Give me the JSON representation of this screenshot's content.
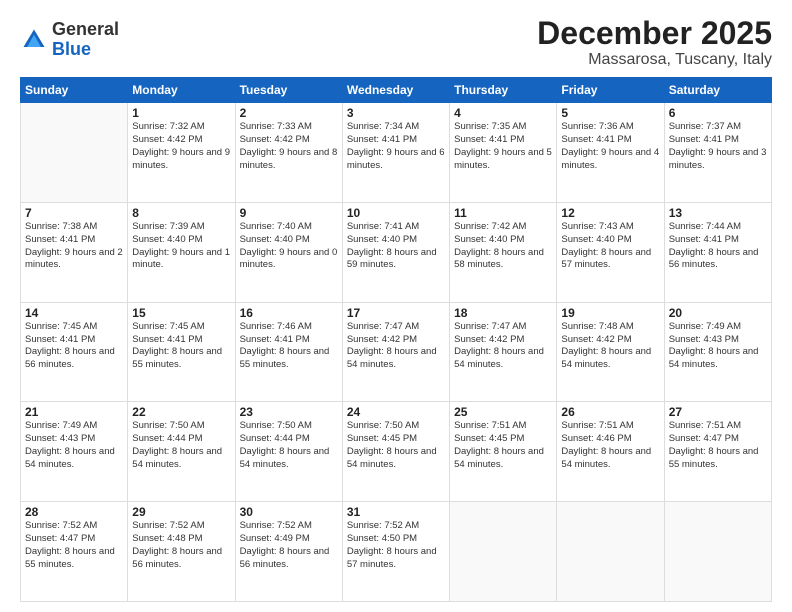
{
  "header": {
    "logo_general": "General",
    "logo_blue": "Blue",
    "month_title": "December 2025",
    "location": "Massarosa, Tuscany, Italy"
  },
  "weekdays": [
    "Sunday",
    "Monday",
    "Tuesday",
    "Wednesday",
    "Thursday",
    "Friday",
    "Saturday"
  ],
  "weeks": [
    [
      {
        "day": "",
        "sunrise": "",
        "sunset": "",
        "daylight": "",
        "empty": true
      },
      {
        "day": "1",
        "sunrise": "Sunrise: 7:32 AM",
        "sunset": "Sunset: 4:42 PM",
        "daylight": "Daylight: 9 hours and 9 minutes."
      },
      {
        "day": "2",
        "sunrise": "Sunrise: 7:33 AM",
        "sunset": "Sunset: 4:42 PM",
        "daylight": "Daylight: 9 hours and 8 minutes."
      },
      {
        "day": "3",
        "sunrise": "Sunrise: 7:34 AM",
        "sunset": "Sunset: 4:41 PM",
        "daylight": "Daylight: 9 hours and 6 minutes."
      },
      {
        "day": "4",
        "sunrise": "Sunrise: 7:35 AM",
        "sunset": "Sunset: 4:41 PM",
        "daylight": "Daylight: 9 hours and 5 minutes."
      },
      {
        "day": "5",
        "sunrise": "Sunrise: 7:36 AM",
        "sunset": "Sunset: 4:41 PM",
        "daylight": "Daylight: 9 hours and 4 minutes."
      },
      {
        "day": "6",
        "sunrise": "Sunrise: 7:37 AM",
        "sunset": "Sunset: 4:41 PM",
        "daylight": "Daylight: 9 hours and 3 minutes."
      }
    ],
    [
      {
        "day": "7",
        "sunrise": "Sunrise: 7:38 AM",
        "sunset": "Sunset: 4:41 PM",
        "daylight": "Daylight: 9 hours and 2 minutes."
      },
      {
        "day": "8",
        "sunrise": "Sunrise: 7:39 AM",
        "sunset": "Sunset: 4:40 PM",
        "daylight": "Daylight: 9 hours and 1 minute."
      },
      {
        "day": "9",
        "sunrise": "Sunrise: 7:40 AM",
        "sunset": "Sunset: 4:40 PM",
        "daylight": "Daylight: 9 hours and 0 minutes."
      },
      {
        "day": "10",
        "sunrise": "Sunrise: 7:41 AM",
        "sunset": "Sunset: 4:40 PM",
        "daylight": "Daylight: 8 hours and 59 minutes."
      },
      {
        "day": "11",
        "sunrise": "Sunrise: 7:42 AM",
        "sunset": "Sunset: 4:40 PM",
        "daylight": "Daylight: 8 hours and 58 minutes."
      },
      {
        "day": "12",
        "sunrise": "Sunrise: 7:43 AM",
        "sunset": "Sunset: 4:40 PM",
        "daylight": "Daylight: 8 hours and 57 minutes."
      },
      {
        "day": "13",
        "sunrise": "Sunrise: 7:44 AM",
        "sunset": "Sunset: 4:41 PM",
        "daylight": "Daylight: 8 hours and 56 minutes."
      }
    ],
    [
      {
        "day": "14",
        "sunrise": "Sunrise: 7:45 AM",
        "sunset": "Sunset: 4:41 PM",
        "daylight": "Daylight: 8 hours and 56 minutes."
      },
      {
        "day": "15",
        "sunrise": "Sunrise: 7:45 AM",
        "sunset": "Sunset: 4:41 PM",
        "daylight": "Daylight: 8 hours and 55 minutes."
      },
      {
        "day": "16",
        "sunrise": "Sunrise: 7:46 AM",
        "sunset": "Sunset: 4:41 PM",
        "daylight": "Daylight: 8 hours and 55 minutes."
      },
      {
        "day": "17",
        "sunrise": "Sunrise: 7:47 AM",
        "sunset": "Sunset: 4:42 PM",
        "daylight": "Daylight: 8 hours and 54 minutes."
      },
      {
        "day": "18",
        "sunrise": "Sunrise: 7:47 AM",
        "sunset": "Sunset: 4:42 PM",
        "daylight": "Daylight: 8 hours and 54 minutes."
      },
      {
        "day": "19",
        "sunrise": "Sunrise: 7:48 AM",
        "sunset": "Sunset: 4:42 PM",
        "daylight": "Daylight: 8 hours and 54 minutes."
      },
      {
        "day": "20",
        "sunrise": "Sunrise: 7:49 AM",
        "sunset": "Sunset: 4:43 PM",
        "daylight": "Daylight: 8 hours and 54 minutes."
      }
    ],
    [
      {
        "day": "21",
        "sunrise": "Sunrise: 7:49 AM",
        "sunset": "Sunset: 4:43 PM",
        "daylight": "Daylight: 8 hours and 54 minutes."
      },
      {
        "day": "22",
        "sunrise": "Sunrise: 7:50 AM",
        "sunset": "Sunset: 4:44 PM",
        "daylight": "Daylight: 8 hours and 54 minutes."
      },
      {
        "day": "23",
        "sunrise": "Sunrise: 7:50 AM",
        "sunset": "Sunset: 4:44 PM",
        "daylight": "Daylight: 8 hours and 54 minutes."
      },
      {
        "day": "24",
        "sunrise": "Sunrise: 7:50 AM",
        "sunset": "Sunset: 4:45 PM",
        "daylight": "Daylight: 8 hours and 54 minutes."
      },
      {
        "day": "25",
        "sunrise": "Sunrise: 7:51 AM",
        "sunset": "Sunset: 4:45 PM",
        "daylight": "Daylight: 8 hours and 54 minutes."
      },
      {
        "day": "26",
        "sunrise": "Sunrise: 7:51 AM",
        "sunset": "Sunset: 4:46 PM",
        "daylight": "Daylight: 8 hours and 54 minutes."
      },
      {
        "day": "27",
        "sunrise": "Sunrise: 7:51 AM",
        "sunset": "Sunset: 4:47 PM",
        "daylight": "Daylight: 8 hours and 55 minutes."
      }
    ],
    [
      {
        "day": "28",
        "sunrise": "Sunrise: 7:52 AM",
        "sunset": "Sunset: 4:47 PM",
        "daylight": "Daylight: 8 hours and 55 minutes."
      },
      {
        "day": "29",
        "sunrise": "Sunrise: 7:52 AM",
        "sunset": "Sunset: 4:48 PM",
        "daylight": "Daylight: 8 hours and 56 minutes."
      },
      {
        "day": "30",
        "sunrise": "Sunrise: 7:52 AM",
        "sunset": "Sunset: 4:49 PM",
        "daylight": "Daylight: 8 hours and 56 minutes."
      },
      {
        "day": "31",
        "sunrise": "Sunrise: 7:52 AM",
        "sunset": "Sunset: 4:50 PM",
        "daylight": "Daylight: 8 hours and 57 minutes."
      },
      {
        "day": "",
        "sunrise": "",
        "sunset": "",
        "daylight": "",
        "empty": true
      },
      {
        "day": "",
        "sunrise": "",
        "sunset": "",
        "daylight": "",
        "empty": true
      },
      {
        "day": "",
        "sunrise": "",
        "sunset": "",
        "daylight": "",
        "empty": true
      }
    ]
  ]
}
